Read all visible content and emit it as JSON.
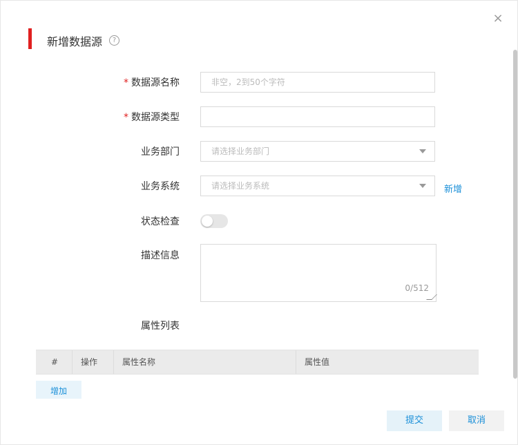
{
  "dialog": {
    "title": "新增数据源",
    "help_icon": "question-circle-icon",
    "close_icon": "close-icon",
    "close_glyph": "×"
  },
  "form": {
    "name": {
      "label": "数据源名称",
      "required": "*",
      "value": "",
      "placeholder": "非空，2到50个字符"
    },
    "type": {
      "label": "数据源类型",
      "required": "*",
      "value": ""
    },
    "department": {
      "label": "业务部门",
      "placeholder": "请选择业务部门"
    },
    "system": {
      "label": "业务系统",
      "placeholder": "请选择业务系统",
      "new_link": "新增"
    },
    "status_check": {
      "label": "状态检查",
      "enabled": false
    },
    "description": {
      "label": "描述信息",
      "counter": "0/512",
      "value": ""
    },
    "attributes": {
      "label": "属性列表"
    }
  },
  "table": {
    "columns": [
      "#",
      "操作",
      "属性名称",
      "属性值"
    ],
    "rows": []
  },
  "buttons": {
    "add": "增加",
    "submit": "提交",
    "cancel": "取消"
  },
  "colors": {
    "accent_red": "#e02020",
    "link_blue": "#1a8fd8"
  }
}
